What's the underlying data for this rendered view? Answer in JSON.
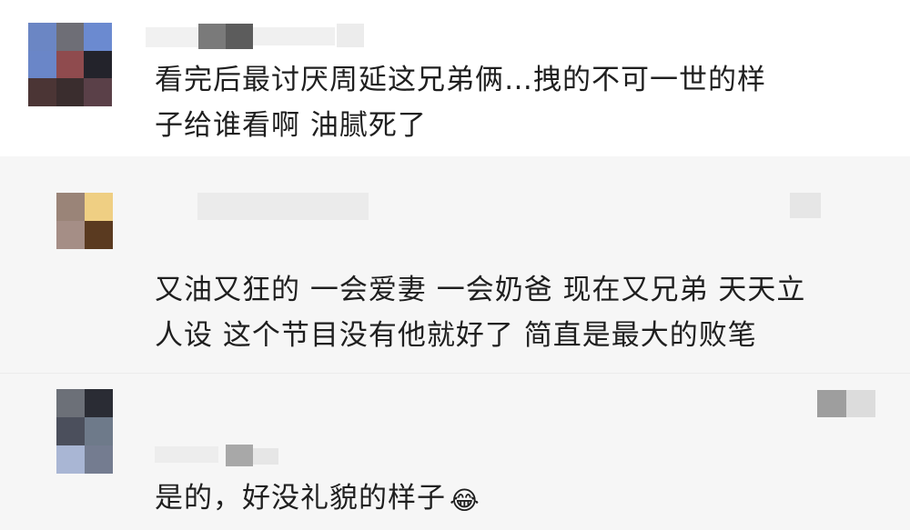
{
  "comments": [
    {
      "text_line1": "看完后最讨厌周延这兄弟俩…拽的不可一世的样",
      "text_line2": "子给谁看啊 油腻死了",
      "avatar_colors": [
        "#6b86c4",
        "#6e6e76",
        "#6b8ad0",
        "#6a86c8",
        "#8f4b4e",
        "#23232b",
        "#4b3535",
        "#3a2d2e",
        "#5a4048"
      ]
    },
    {
      "text_line1": "又油又狂的 一会爱妻 一会奶爸 现在又兄弟 天天立",
      "text_line2": "人设 这个节目没有他就好了 简直是最大的败笔",
      "avatar_colors": [
        "#9a8478",
        "#efcf83",
        "#a58e86",
        "#5a3a20"
      ]
    },
    {
      "text_line1": "是的，好没礼貌的样子",
      "emoji": "😂",
      "avatar_colors": [
        "#6c7078",
        "#2a2c34",
        "#4b4f5c",
        "#6e7a8a",
        "#a9b6d4",
        "#747c90"
      ]
    }
  ]
}
